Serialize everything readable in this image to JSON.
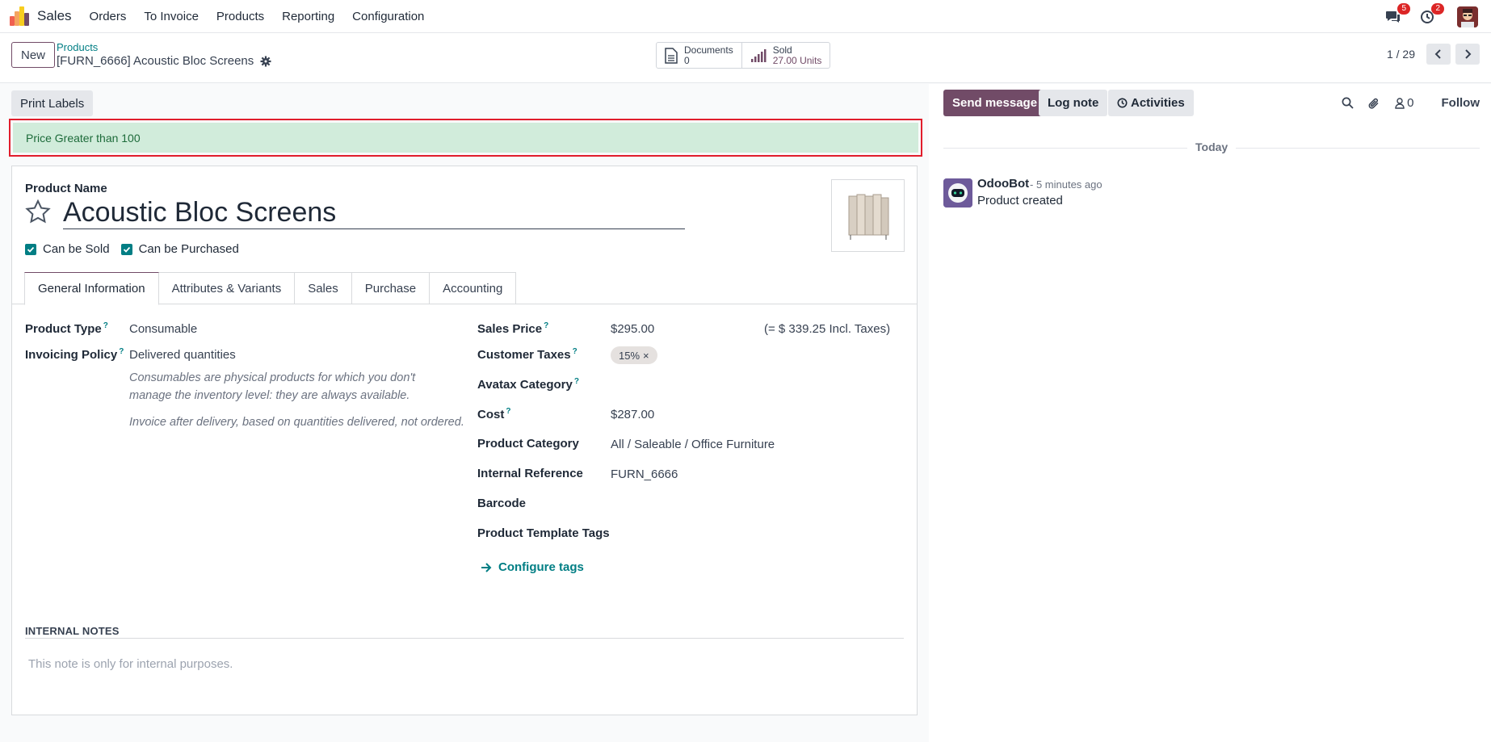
{
  "navbar": {
    "app_name": "Sales",
    "menu": [
      "Orders",
      "To Invoice",
      "Products",
      "Reporting",
      "Configuration"
    ],
    "messages_badge": "5",
    "activities_badge": "2"
  },
  "control": {
    "new_label": "New",
    "breadcrumb_parent": "Products",
    "breadcrumb_current": "[FURN_6666] Acoustic Bloc Screens",
    "documents_label": "Documents",
    "documents_value": "0",
    "sold_label": "Sold",
    "sold_value": "27.00 Units",
    "pager": "1 / 29"
  },
  "form": {
    "print_labels": "Print Labels",
    "alert_text": "Price Greater than 100",
    "product_name_label": "Product Name",
    "product_name": "Acoustic Bloc Screens",
    "can_be_sold": "Can be Sold",
    "can_be_purchased": "Can be Purchased",
    "tabs": [
      "General Information",
      "Attributes & Variants",
      "Sales",
      "Purchase",
      "Accounting"
    ],
    "left_fields": {
      "product_type_label": "Product Type",
      "product_type": "Consumable",
      "invoicing_policy_label": "Invoicing Policy",
      "invoicing_policy": "Delivered quantities",
      "help_1": "Consumables are physical products for which you don't manage the inventory level: they are always available.",
      "help_2": "Invoice after delivery, based on quantities delivered, not ordered."
    },
    "right_fields": {
      "sales_price_label": "Sales Price",
      "sales_price": "$295.00",
      "incl_taxes": "(= $ 339.25 Incl. Taxes)",
      "customer_taxes_label": "Customer Taxes",
      "customer_tax_tag": "15%",
      "avatax_label": "Avatax Category",
      "cost_label": "Cost",
      "cost": "$287.00",
      "category_label": "Product Category",
      "category": "All / Saleable / Office Furniture",
      "internal_ref_label": "Internal Reference",
      "internal_ref": "FURN_6666",
      "barcode_label": "Barcode",
      "tags_label": "Product Template Tags",
      "configure_tags": "Configure tags"
    },
    "internal_notes_title": "INTERNAL NOTES",
    "internal_notes_placeholder": "This note is only for internal purposes."
  },
  "chatter": {
    "send_message": "Send message",
    "log_note": "Log note",
    "activities": "Activities",
    "followers_count": "0",
    "follow": "Follow",
    "today": "Today",
    "message": {
      "author": "OdooBot",
      "time": "- 5 minutes ago",
      "body": "Product created"
    }
  },
  "colors": {
    "brand": "#714b67",
    "teal": "#017e84",
    "alert_bg": "#d1ecdb",
    "highlight": "#e11d2c"
  }
}
